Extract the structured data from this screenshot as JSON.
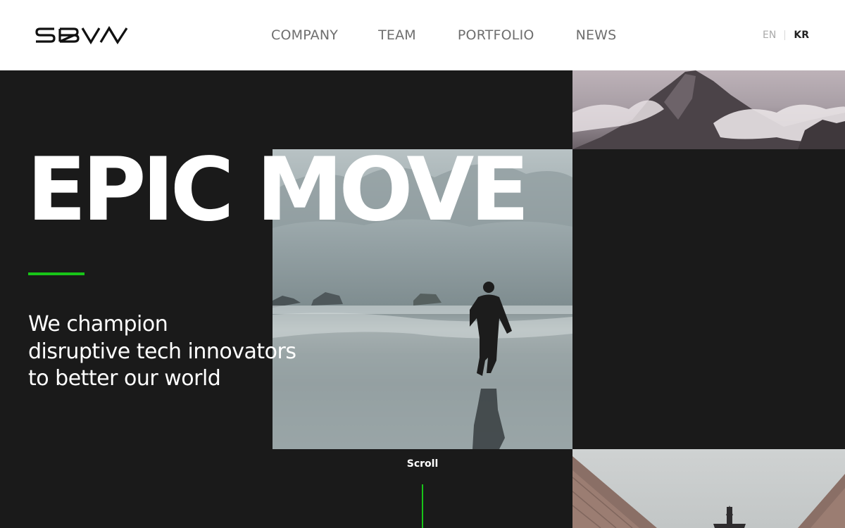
{
  "header": {
    "logo_text": "SBVA",
    "nav": [
      {
        "label": "COMPANY"
      },
      {
        "label": "TEAM"
      },
      {
        "label": "PORTFOLIO"
      },
      {
        "label": "NEWS"
      }
    ],
    "languages": {
      "en": "EN",
      "kr": "KR",
      "active": "KR"
    }
  },
  "hero": {
    "headline": "EPIC MOVE",
    "tagline_lines": [
      "We champion",
      "disruptive tech innovators",
      "to better our world"
    ],
    "scroll_label": "Scroll",
    "accent_color": "#18c418",
    "images": [
      {
        "name": "mountain-image",
        "subject": "misty mountain peak above clouds"
      },
      {
        "name": "beach-runner-image",
        "subject": "person running on wet beach"
      },
      {
        "name": "airplane-image",
        "subject": "airplane between buildings"
      }
    ]
  }
}
